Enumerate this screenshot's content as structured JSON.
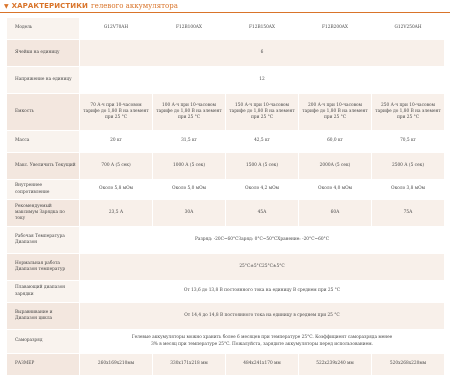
{
  "section": {
    "arrow": "▼",
    "title_caps": "ХАРАКТЕРИСТИКИ",
    "title_rest": "гелевого аккумулятора",
    "accent_color": "#d9742a"
  },
  "table": {
    "header": [
      "Модель",
      "G12V70AH",
      "F12B100AX",
      "F12B150AX",
      "F12B200AX",
      "G12V250AH"
    ],
    "rows": [
      {
        "label": "Ячейки на единицу",
        "span": "6"
      },
      {
        "label": "Напряжение на единицу",
        "span": "12"
      },
      {
        "label": "Емкость",
        "cells": [
          "70 А·ч при 10-часовом тарифе до 1,80 В на элемент при 25 °C",
          "100 А·ч при 10-часовом тарифе до 1,80 В на элемент при 25 °C",
          "150 А·ч при 10-часовом тарифе до 1,80 В на элемент при 25 °C",
          "200 А·ч при 10-часовом тарифе до 1,80 В на элемент при 25 °C",
          "250 А·ч при 10-часовом тарифе до 1,80 В на элемент при 25 °C"
        ]
      },
      {
        "label": "Масса",
        "cells": [
          "20 кг",
          "31,5 кг",
          "42,5 кг",
          "60,0 кг",
          "70,5 кг"
        ]
      },
      {
        "label": "Макс. Увеличить Текущий",
        "cells": [
          "700 А (5 сек)",
          "1000 А (5 сек)",
          "1500 А (5 сек)",
          "2000А (5 сек)",
          "2500 А (5 сек)"
        ]
      },
      {
        "label": "Внутреннее сопротивление",
        "cells": [
          "Около 5,8 мОм",
          "Около 5,0 мОм",
          "Около 4,2 мОм",
          "Около 4,0 мОм",
          "Около 3,8 мОм"
        ]
      },
      {
        "label": "Рекомендуемый максимум Зарядка по току",
        "cells": [
          "23,5 А",
          "30А",
          "45А",
          "60А",
          "75А"
        ]
      },
      {
        "label": "Рабочая Температура Диапазон",
        "span": "Разряд: -20C~60°CЗаряд: 0°C~50°CХранение: -20°C~60°C"
      },
      {
        "label": "Нормальная работа Диапазон температур",
        "span": "25°C±5°C25°C±5°C"
      },
      {
        "label": "Плавающий диапазон зарядки",
        "span": "От 13,6 до 13,8 В постоянного тока на единицу В среднем при 25 °C"
      },
      {
        "label": "Выравнивание и Диапазон цикла",
        "span": "От 14,4 до 14,8 В постоянного тока на единицу в среднем при 25 °C"
      },
      {
        "label": "Саморазряд",
        "span": "Гелевые аккумуляторы можно хранить более 6 месяцев при температуре 25°C. Коэффициент саморазряда менее 3% в месяц при температуре 25°C. Пожалуйста, зарядите аккумуляторы перед использованием."
      },
      {
        "label": "РАЗМЕР",
        "cells": [
          "260x169x210мм",
          "330x171x218 мм",
          "484x241x170 мм",
          "522x239x240 мм",
          "520x268x220мм"
        ]
      }
    ]
  }
}
